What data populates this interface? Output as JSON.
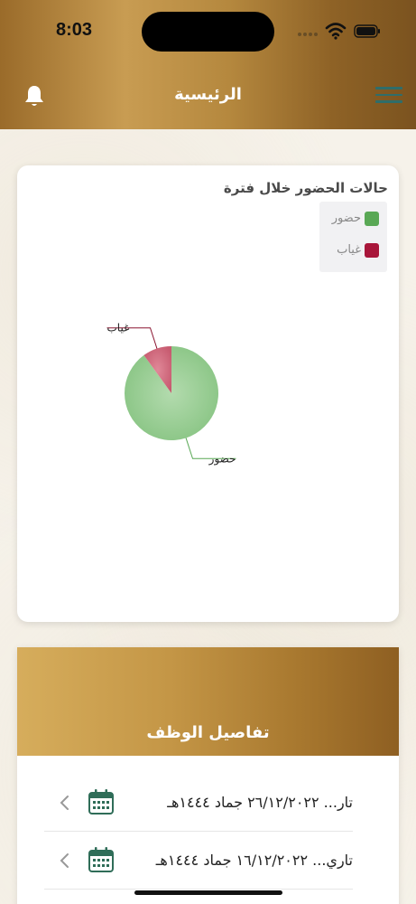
{
  "status_bar": {
    "time": "8:03"
  },
  "header": {
    "title": "الرئيسية"
  },
  "attendance_chart": {
    "title": "حالات الحضور خلال فترة",
    "legend": [
      {
        "label": "حضور",
        "color": "#59a855"
      },
      {
        "label": "غياب",
        "color": "#a8163a"
      }
    ]
  },
  "chart_data": {
    "type": "pie",
    "title": "حالات الحضور خلال فترة",
    "slices": [
      {
        "label": "حضور",
        "value": 90,
        "color": "#8fc98a"
      },
      {
        "label": "غياب",
        "value": 10,
        "color": "#cc5f73"
      }
    ],
    "legend_position": "top-right"
  },
  "job_details": {
    "title": "تفاصيل الوظف",
    "rows": [
      {
        "text": "تار... ٢٦/١٢/٢٠٢٢ جماد ١٤٤٤هـ"
      },
      {
        "text": "تاري... ١٦/١٢/٢٠٢٢ جماد ١٤٤٤هـ"
      }
    ]
  }
}
